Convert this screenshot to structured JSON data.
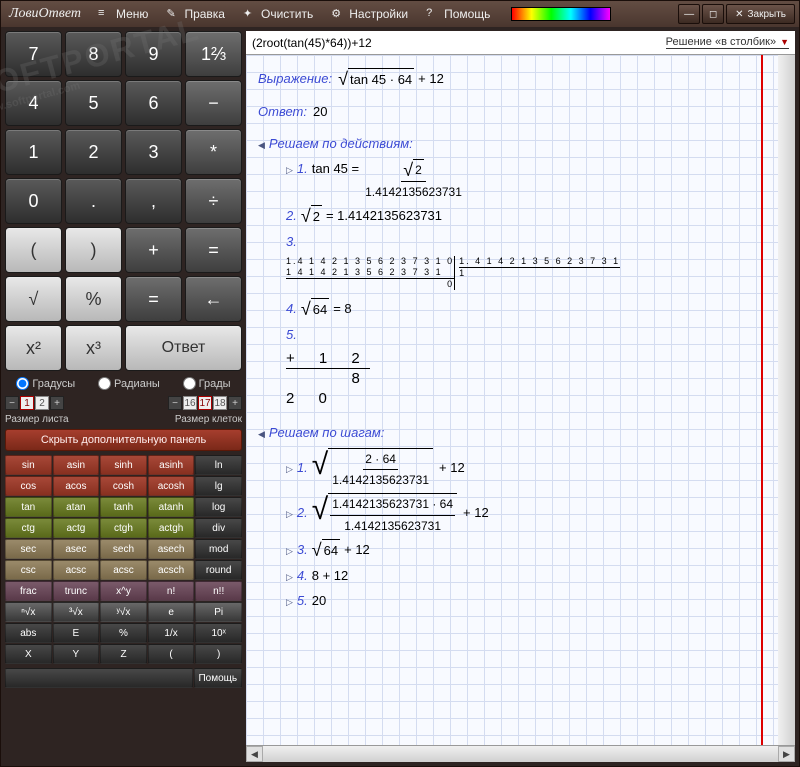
{
  "app": {
    "title": "ЛовиОтвет"
  },
  "menu": {
    "menu": "Меню",
    "edit": "Правка",
    "clear": "Очистить",
    "settings": "Настройки",
    "help": "Помощь",
    "close": "Закрыть"
  },
  "keypad": {
    "r1": [
      "7",
      "8",
      "9",
      "1⅔"
    ],
    "r2": [
      "4",
      "5",
      "6",
      "−"
    ],
    "r3": [
      "1",
      "2",
      "3",
      "*"
    ],
    "r4": [
      "0",
      ".",
      ",",
      "÷"
    ],
    "r5": [
      "(",
      ")",
      "+",
      "="
    ],
    "r6": [
      "√",
      "%",
      "=",
      "←"
    ],
    "r7": [
      "x²",
      "x³",
      "Ответ"
    ]
  },
  "angles": {
    "deg": "Градусы",
    "rad": "Радианы",
    "grad": "Грады",
    "selected": "deg"
  },
  "sizes": {
    "left_label": "Размер листа",
    "right_label": "Размер клеток",
    "sheet": [
      "1",
      "2"
    ],
    "cells": [
      "16",
      "17",
      "18"
    ]
  },
  "hide_panel": "Скрыть дополнительную панель",
  "funcs": [
    [
      "sin",
      "asin",
      "sinh",
      "asinh",
      "ln"
    ],
    [
      "cos",
      "acos",
      "cosh",
      "acosh",
      "lg"
    ],
    [
      "tan",
      "atan",
      "tanh",
      "atanh",
      "log"
    ],
    [
      "ctg",
      "actg",
      "ctgh",
      "actgh",
      "div"
    ],
    [
      "sec",
      "asec",
      "sech",
      "asech",
      "mod"
    ],
    [
      "csc",
      "acsc",
      "acsc",
      "acsch",
      "round"
    ],
    [
      "frac",
      "trunc",
      "x^y",
      "n!",
      "n!!"
    ],
    [
      "ⁿ√x",
      "³√x",
      "ʸ√x",
      "e",
      "Pi"
    ],
    [
      "abs",
      "E",
      "%",
      "1/x",
      "10ˣ"
    ],
    [
      "X",
      "Y",
      "Z",
      "(",
      ")"
    ]
  ],
  "func_colors": [
    [
      "fk-red",
      "fk-red",
      "fk-red",
      "fk-red",
      "fk-blk"
    ],
    [
      "fk-red",
      "fk-red",
      "fk-red",
      "fk-red",
      "fk-blk"
    ],
    [
      "fk-green",
      "fk-green",
      "fk-green",
      "fk-green",
      "fk-blk"
    ],
    [
      "fk-green",
      "fk-green",
      "fk-green",
      "fk-green",
      "fk-blk"
    ],
    [
      "fk-tan",
      "fk-tan",
      "fk-tan",
      "fk-tan",
      "fk-blk"
    ],
    [
      "fk-tan",
      "fk-tan",
      "fk-tan",
      "fk-tan",
      "fk-blk"
    ],
    [
      "fk-prp",
      "fk-prp",
      "fk-prp",
      "fk-prp",
      "fk-prp"
    ],
    [
      "fk-drk",
      "fk-drk",
      "fk-drk",
      "fk-drk",
      "fk-drk"
    ],
    [
      "fk-blk",
      "fk-blk",
      "fk-blk",
      "fk-blk",
      "fk-blk"
    ],
    [
      "fk-blk",
      "fk-blk",
      "fk-blk",
      "fk-blk",
      "fk-blk"
    ]
  ],
  "bottom_btn": "Помощь",
  "formula": "(2root(tan(45)*64))+12",
  "style_label": "Решение «в столбик»",
  "solution": {
    "expr_label": "Выражение:",
    "expr_radicand": "tan 45 · 64",
    "expr_plus": "+ 12",
    "answer_label": "Ответ:",
    "answer_value": "20",
    "actions_label": "Решаем по действиям:",
    "steps_label": "Решаем по шагам:",
    "tan45": "tan 45 =",
    "sqrt2": "2",
    "val1": "1.4142135623731",
    "step2": "= 1.4142135623731",
    "step3_num": "3.",
    "longdiv_l1": "1.4 1 4 2 1 3 5 6 2 3 7 3 1 0",
    "longdiv_l2": "1 4 1 4 2 1 3 5 6 2 3 7 3 1",
    "longdiv_l3": "0",
    "longdiv_r": "1. 4 1 4 2 1 3 5 6 2 3 7 3 1",
    "longdiv_q": "1",
    "step4": "= 8",
    "step4_rad": "64",
    "step5_num": "5.",
    "col_plus": "+ 1 2",
    "col_8": "8",
    "col_20": "2 0",
    "bs1_top": "2 · 64",
    "bs1_bot": "1.4142135623731",
    "bs_plus": "+ 12",
    "bs2_top": "1.4142135623731 · 64",
    "bs2_bot": "1.4142135623731",
    "bs3": "64 + 12",
    "bs4": "8 + 12",
    "bs5": "20"
  },
  "watermark": "SOFTPORTAL",
  "watermark_sub": "www.softportal.com"
}
